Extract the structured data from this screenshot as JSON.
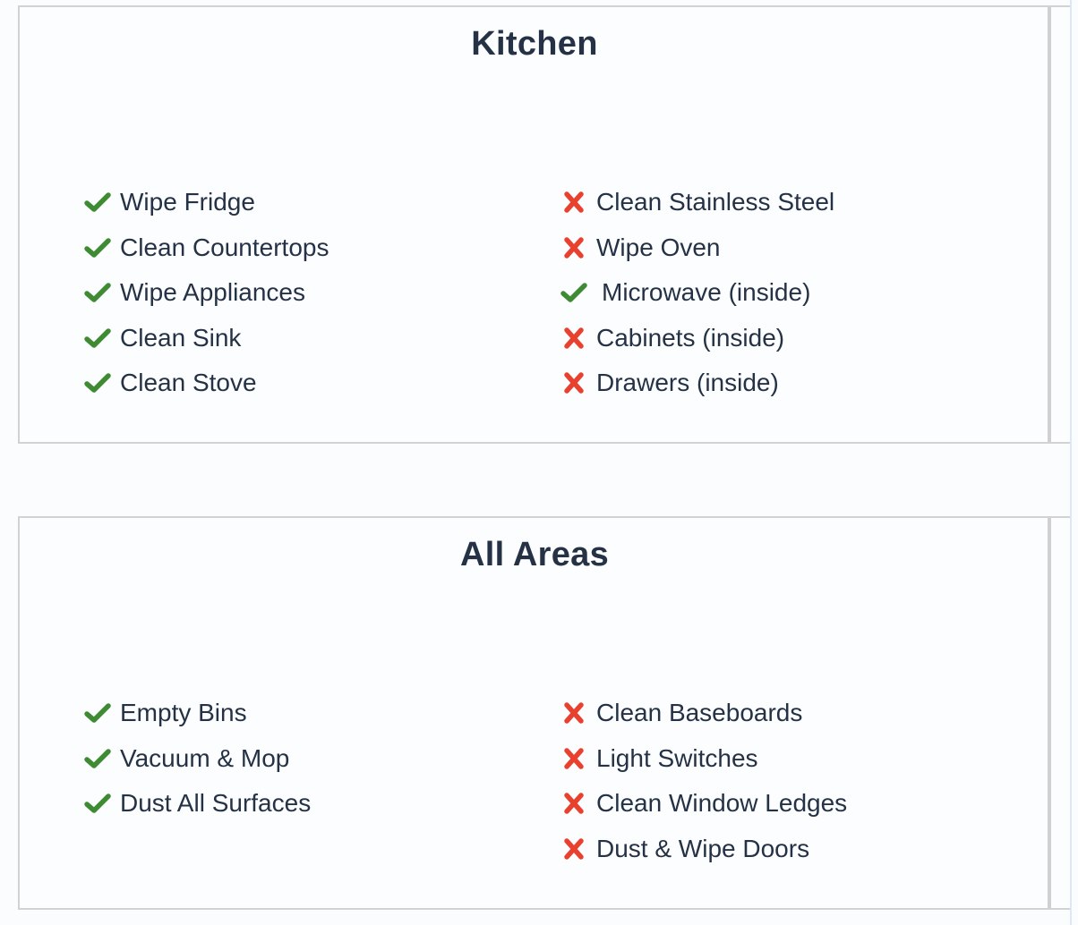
{
  "colors": {
    "done": "#3e8b34",
    "not_done": "#e8412f",
    "text": "#253246",
    "border": "#d2d2d2"
  },
  "sections": [
    {
      "title": "Kitchen",
      "left_items": [
        {
          "label": "Wipe Fridge",
          "status": "done",
          "icon": "check-icon"
        },
        {
          "label": "Clean Countertops",
          "status": "done",
          "icon": "check-icon"
        },
        {
          "label": "Wipe Appliances",
          "status": "done",
          "icon": "check-icon"
        },
        {
          "label": "Clean Sink",
          "status": "done",
          "icon": "check-icon"
        },
        {
          "label": "Clean Stove",
          "status": "done",
          "icon": "check-icon"
        }
      ],
      "right_items": [
        {
          "label": "Clean Stainless Steel",
          "status": "not_done",
          "icon": "cross-icon"
        },
        {
          "label": "Wipe Oven",
          "status": "not_done",
          "icon": "cross-icon"
        },
        {
          "label": "Microwave (inside)",
          "status": "done",
          "icon": "check-icon"
        },
        {
          "label": "Cabinets (inside)",
          "status": "not_done",
          "icon": "cross-icon"
        },
        {
          "label": "Drawers (inside)",
          "status": "not_done",
          "icon": "cross-icon"
        }
      ]
    },
    {
      "title": "All Areas",
      "left_items": [
        {
          "label": "Empty Bins",
          "status": "done",
          "icon": "check-icon"
        },
        {
          "label": "Vacuum & Mop",
          "status": "done",
          "icon": "check-icon"
        },
        {
          "label": "Dust All Surfaces",
          "status": "done",
          "icon": "check-icon"
        }
      ],
      "right_items": [
        {
          "label": "Clean Baseboards",
          "status": "not_done",
          "icon": "cross-icon"
        },
        {
          "label": "Light Switches",
          "status": "not_done",
          "icon": "cross-icon"
        },
        {
          "label": "Clean Window Ledges",
          "status": "not_done",
          "icon": "cross-icon"
        },
        {
          "label": "Dust & Wipe Doors",
          "status": "not_done",
          "icon": "cross-icon"
        }
      ]
    }
  ]
}
